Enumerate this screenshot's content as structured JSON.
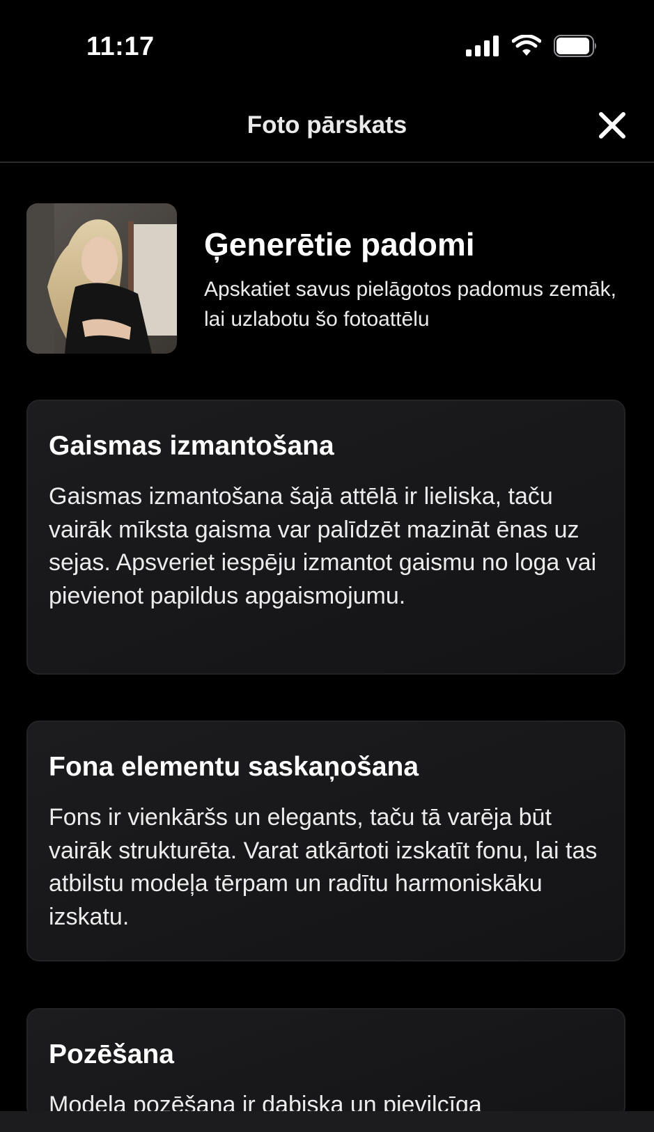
{
  "status_bar": {
    "time": "11:17",
    "icons": [
      "signal-icon",
      "wifi-icon",
      "battery-icon"
    ]
  },
  "header": {
    "title": "Foto pārskats",
    "close_icon": "close-icon"
  },
  "intro": {
    "title": "Ģenerētie padomi",
    "subtitle": "Apskatiet savus pielāgotos padomus zemāk, lai uzlabotu šo fotoattēlu"
  },
  "tips": [
    {
      "title": "Gaismas izmantošana",
      "body": "Gaismas izmantošana šajā attēlā ir lieliska, taču vairāk mīksta gaisma var palīdzēt mazināt ēnas uz sejas. Apsveriet iespēju izmantot gaismu no loga vai pievienot papildus apgaismojumu."
    },
    {
      "title": "Fona elementu saskaņošana",
      "body": "Fons ir vienkāršs un elegants, taču tā varēja būt vairāk strukturēta. Varat atkārtoti izskatīt fonu, lai tas atbilstu modeļa tērpam un radītu harmoniskāku izskatu."
    },
    {
      "title": "Pozēšana",
      "body": "Modeļa pozēšana ir dabiska un pievilcīga"
    }
  ],
  "colors": {
    "background": "#000000",
    "card": "#1c1c1e",
    "text": "#ffffff"
  }
}
